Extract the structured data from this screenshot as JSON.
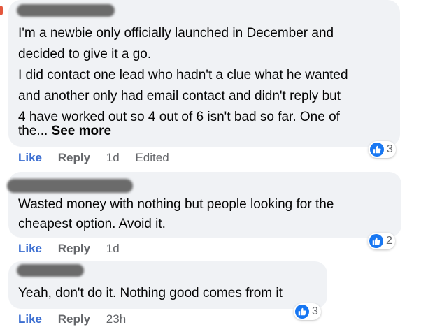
{
  "colors": {
    "bubble_bg": "#f0f2f5",
    "like_blue": "#3b6ed1",
    "meta_gray": "#65676b",
    "reaction_blue": "#1877f2"
  },
  "comments": [
    {
      "author": "[redacted]",
      "lines": [
        "I'm a newbie only officially launched in December and",
        "decided to give it a go.",
        "I did contact one lead who hadn't a clue what he wanted",
        "and another only had email contact and didn't reply but",
        "4 have worked out so 4 out of 6 isn't bad so far. One of",
        "the..."
      ],
      "see_more": "See more",
      "actions": {
        "like": "Like",
        "reply": "Reply",
        "time": "1d",
        "edited": "Edited"
      },
      "reaction": {
        "icon": "like-thumb-icon",
        "count": "3"
      }
    },
    {
      "author": "[redacted]",
      "lines": [
        "Wasted money with nothing but people looking for the",
        "cheapest option. Avoid it."
      ],
      "actions": {
        "like": "Like",
        "reply": "Reply",
        "time": "1d"
      },
      "reaction": {
        "icon": "like-thumb-icon",
        "count": "2"
      }
    },
    {
      "author": "[redacted]",
      "lines": [
        "Yeah, don't do it. Nothing good comes from it"
      ],
      "actions": {
        "like": "Like",
        "reply": "Reply",
        "time": "23h"
      },
      "reaction": {
        "icon": "like-thumb-icon",
        "count": "3"
      }
    }
  ]
}
